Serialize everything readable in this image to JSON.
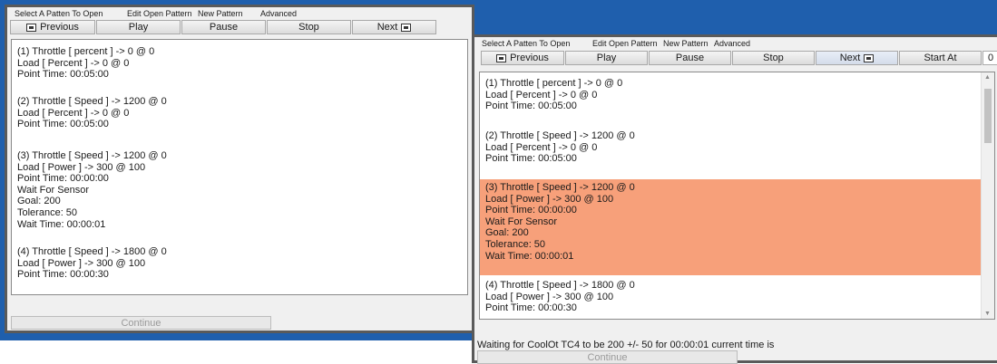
{
  "menu": {
    "select": "Select A Patten To Open",
    "edit": "Edit Open Pattern",
    "new": "New Pattern",
    "advanced": "Advanced"
  },
  "toolbar": {
    "previous": "Previous",
    "play": "Play",
    "pause": "Pause",
    "stop": "Stop",
    "next": "Next",
    "start_at": "Start At",
    "counter": "0"
  },
  "steps": [
    {
      "lines": [
        "(1) Throttle [ percent ] -> 0 @ 0",
        "Load [ Percent ] -> 0 @ 0",
        "Point Time: 00:05:00"
      ]
    },
    {
      "lines": [
        "(2) Throttle [ Speed ] -> 1200 @ 0",
        "Load [ Percent ] -> 0 @ 0",
        "Point Time: 00:05:00"
      ]
    },
    {
      "lines": [
        "(3) Throttle [ Speed ] -> 1200 @ 0",
        "Load [ Power ] -> 300 @ 100",
        "Point Time: 00:00:00",
        "Wait For Sensor",
        "Goal: 200",
        "Tolerance: 50",
        "Wait Time: 00:00:01"
      ]
    },
    {
      "lines": [
        "(4) Throttle [ Speed ] -> 1800 @ 0",
        "Load [ Power ] -> 300 @ 100",
        "Point Time: 00:00:30"
      ]
    }
  ],
  "continue_label": "Continue",
  "status_text": "Waiting for CoolOt TC4 to be 200 +/- 50 for 00:00:01 current time is",
  "highlight_color": "#f7a07a"
}
